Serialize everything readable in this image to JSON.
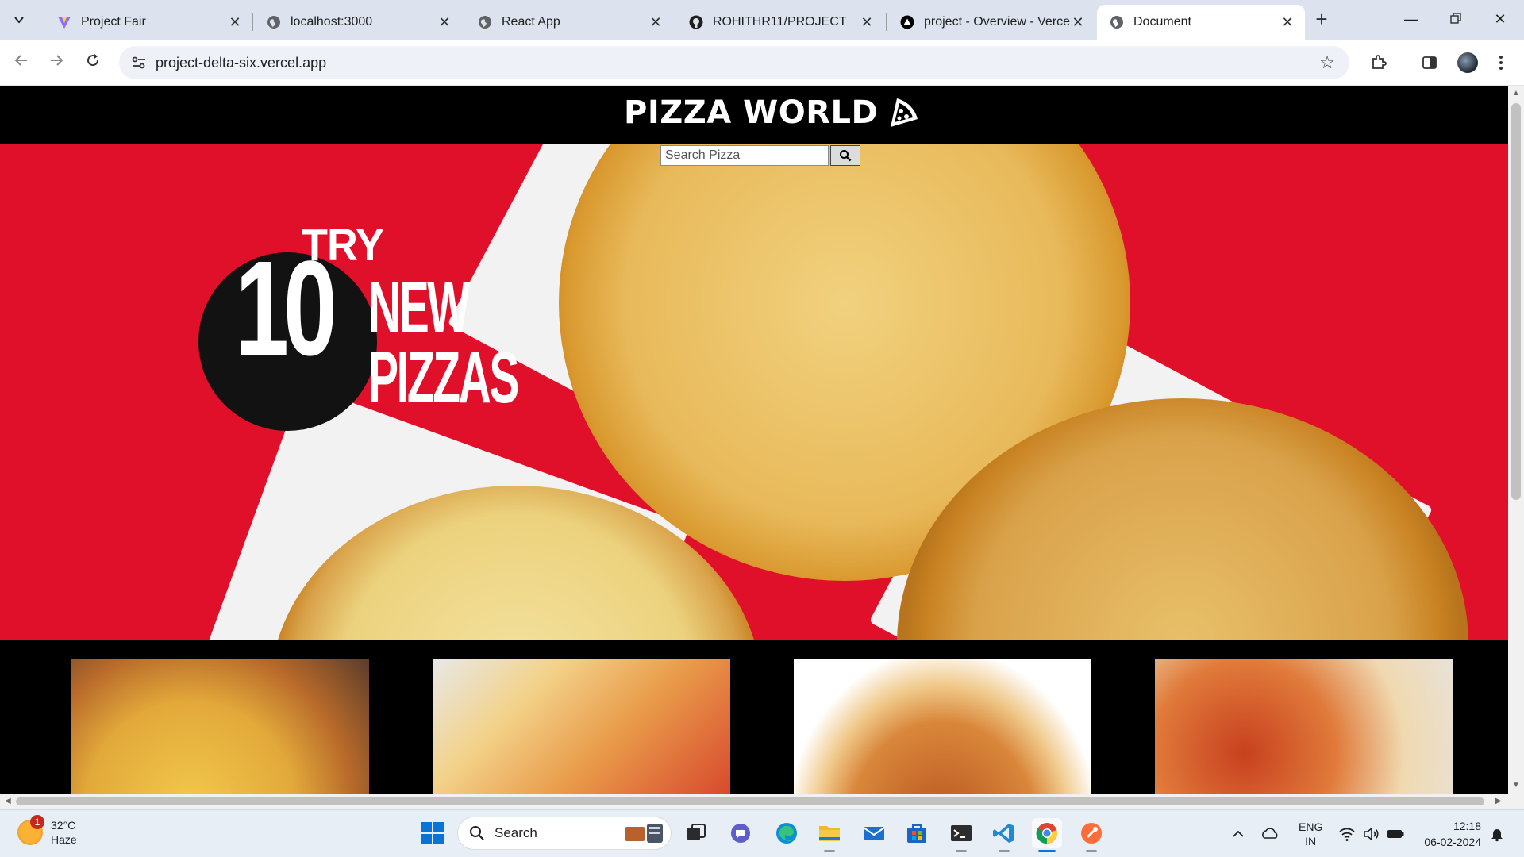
{
  "browser": {
    "tabs": [
      {
        "title": "Project Fair",
        "icon": "vite-icon",
        "active": false
      },
      {
        "title": "localhost:3000",
        "icon": "globe-icon",
        "active": false
      },
      {
        "title": "React App",
        "icon": "globe-icon",
        "active": false
      },
      {
        "title": "ROHITHR11/PROJECT",
        "icon": "github-icon",
        "active": false
      },
      {
        "title": "project - Overview - Vercel",
        "icon": "vercel-icon",
        "active": false
      },
      {
        "title": "Document",
        "icon": "globe-icon",
        "active": true
      }
    ],
    "url": "project-delta-six.vercel.app"
  },
  "page": {
    "brand": "PIZZA WORLD",
    "search_placeholder": "Search Pizza",
    "promo": {
      "line1": "TRY",
      "number": "10",
      "line2": "NEW",
      "line3": "PIZZAS"
    }
  },
  "taskbar": {
    "weather": {
      "temp": "32°C",
      "condition": "Haze",
      "badge": "1"
    },
    "search_label": "Search",
    "lang": {
      "line1": "ENG",
      "line2": "IN"
    },
    "time": "12:18",
    "date": "06-02-2024"
  },
  "colors": {
    "hero_red": "#e1102a",
    "header_black": "#000000",
    "chrome_tabstrip": "#dde3ee"
  }
}
